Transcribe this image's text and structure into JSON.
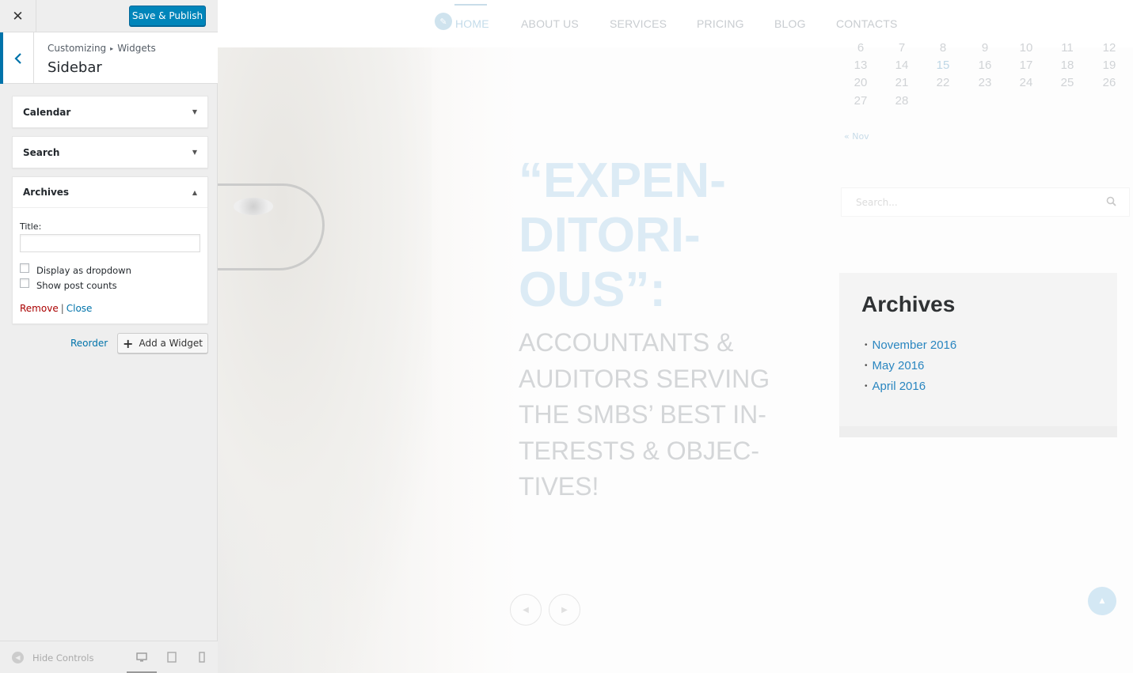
{
  "customizer": {
    "close_glyph": "✕",
    "save_label": "Save & Publish",
    "breadcrumb": {
      "root": "Customizing",
      "sep": "▸",
      "child": "Widgets"
    },
    "section_title": "Sidebar",
    "widgets": [
      {
        "title": "Calendar",
        "expanded": false
      },
      {
        "title": "Search",
        "expanded": false
      },
      {
        "title": "Archives",
        "expanded": true
      }
    ],
    "archives_form": {
      "title_label": "Title:",
      "title_value": "",
      "options": [
        {
          "label": "Display as dropdown",
          "checked": false
        },
        {
          "label": "Show post counts",
          "checked": false
        }
      ],
      "remove_label": "Remove",
      "separator": "|",
      "close_label": "Close"
    },
    "reorder_label": "Reorder",
    "add_widget_label": "Add a Widget",
    "footer": {
      "hide_controls_label": "Hide Controls",
      "active_device": "desktop"
    }
  },
  "preview": {
    "nav": [
      "HOME",
      "ABOUT US",
      "SERVICES",
      "PRICING",
      "BLOG",
      "CONTACTS"
    ],
    "active_nav": "HOME",
    "hero_quote_lines": [
      "“EXPEN-",
      "DITORI-",
      "OUS”:"
    ],
    "hero_sub_lines": [
      "ACCOUNTANTS &",
      "AUDITORS SERVING",
      "THE SMBS’ BEST IN-",
      "TERESTS & OBJEC-",
      "TIVES!"
    ],
    "calendar_rows": [
      [
        "6",
        "7",
        "8",
        "9",
        "10",
        "11",
        "12"
      ],
      [
        "13",
        "14",
        "15",
        "16",
        "17",
        "18",
        "19"
      ],
      [
        "20",
        "21",
        "22",
        "23",
        "24",
        "25",
        "26"
      ],
      [
        "27",
        "28",
        "",
        "",
        "",
        "",
        ""
      ]
    ],
    "calendar_link_day": "15",
    "prev_month": "« Nov",
    "search_placeholder": "Search...",
    "archives_title": "Archives",
    "archives_items": [
      "November 2016",
      "May 2016",
      "April 2016"
    ],
    "colors": {
      "accent": "#0085ba",
      "link": "#2a86c0",
      "remove": "#aa0000"
    }
  }
}
